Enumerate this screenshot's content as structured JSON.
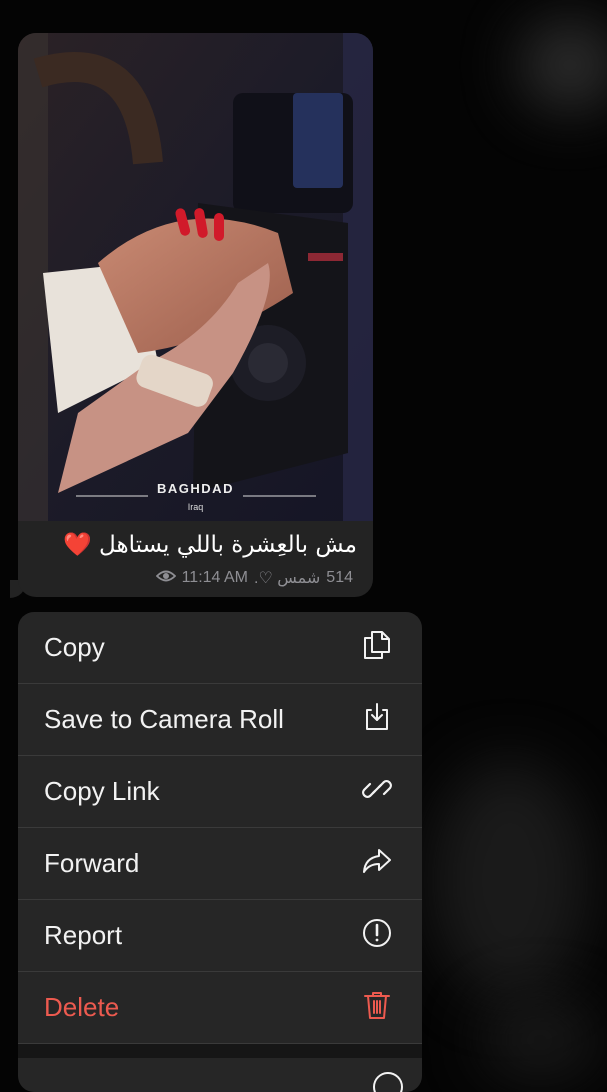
{
  "photo": {
    "overlay_city": "BAGHDAD",
    "overlay_country": "Iraq"
  },
  "message": {
    "caption": "مش بالعِشرة باللي يستاهل",
    "caption_emoji": "❤️",
    "views": "514",
    "author": "شمس ♡.",
    "time": "11:14 AM"
  },
  "menu": {
    "items": [
      {
        "label": "Copy",
        "icon": "copy-icon"
      },
      {
        "label": "Save to Camera Roll",
        "icon": "download-icon"
      },
      {
        "label": "Copy Link",
        "icon": "link-icon"
      },
      {
        "label": "Forward",
        "icon": "forward-icon"
      },
      {
        "label": "Report",
        "icon": "report-icon"
      },
      {
        "label": "Delete",
        "icon": "trash-icon",
        "color": "#ec5a4f"
      }
    ]
  }
}
